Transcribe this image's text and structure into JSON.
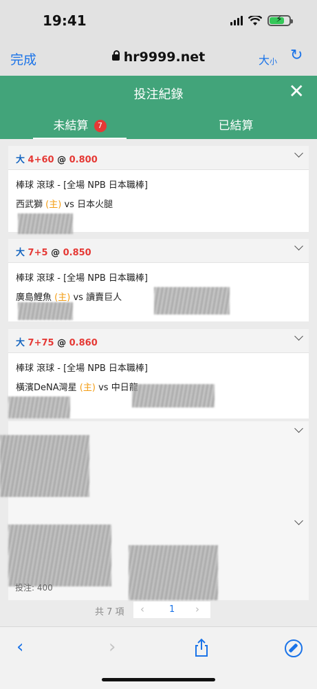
{
  "status": {
    "time": "19:41"
  },
  "browser": {
    "done_label": "完成",
    "url": "hr9999.net",
    "text_size_big": "大",
    "text_size_small": "小",
    "reload_icon": "reload-icon"
  },
  "modal": {
    "title": "投注紀錄",
    "close_icon": "close-icon"
  },
  "tabs": {
    "unsettled": "未結算",
    "unsettled_count": "7",
    "settled": "已結算"
  },
  "bets": [
    {
      "type": "大",
      "line": "4+60",
      "at": "@",
      "odds": "0.800",
      "league": "棒球 滾球 - [全場 NPB 日本職棒]",
      "home": "西武獅",
      "home_tag": "(主)",
      "vs": "vs",
      "away": "日本火腿"
    },
    {
      "type": "大",
      "line": "7+5",
      "at": "@",
      "odds": "0.850",
      "league": "棒球 滾球 - [全場 NPB 日本職棒]",
      "home": "廣島鯉魚",
      "home_tag": "(主)",
      "vs": "vs",
      "away": "讀賣巨人"
    },
    {
      "type": "大",
      "line": "7+75",
      "at": "@",
      "odds": "0.860",
      "league": "棒球 滾球 - [全場 NPB 日本職棒]",
      "home": "橫濱DeNA灣星",
      "home_tag": "(主)",
      "vs": "vs",
      "away": "中日龍"
    }
  ],
  "stake_label": "投注: 400",
  "pager": {
    "total": "共 7 項",
    "prev": "‹",
    "page": "1",
    "next": "›"
  },
  "toolbar": {
    "back": "‹",
    "forward": "›",
    "share_icon": "share-icon",
    "compass_icon": "compass-icon"
  },
  "colors": {
    "accent": "#42a47a",
    "blue": "#1565c0",
    "red": "#e53935",
    "home_tag": "#f39c12"
  }
}
